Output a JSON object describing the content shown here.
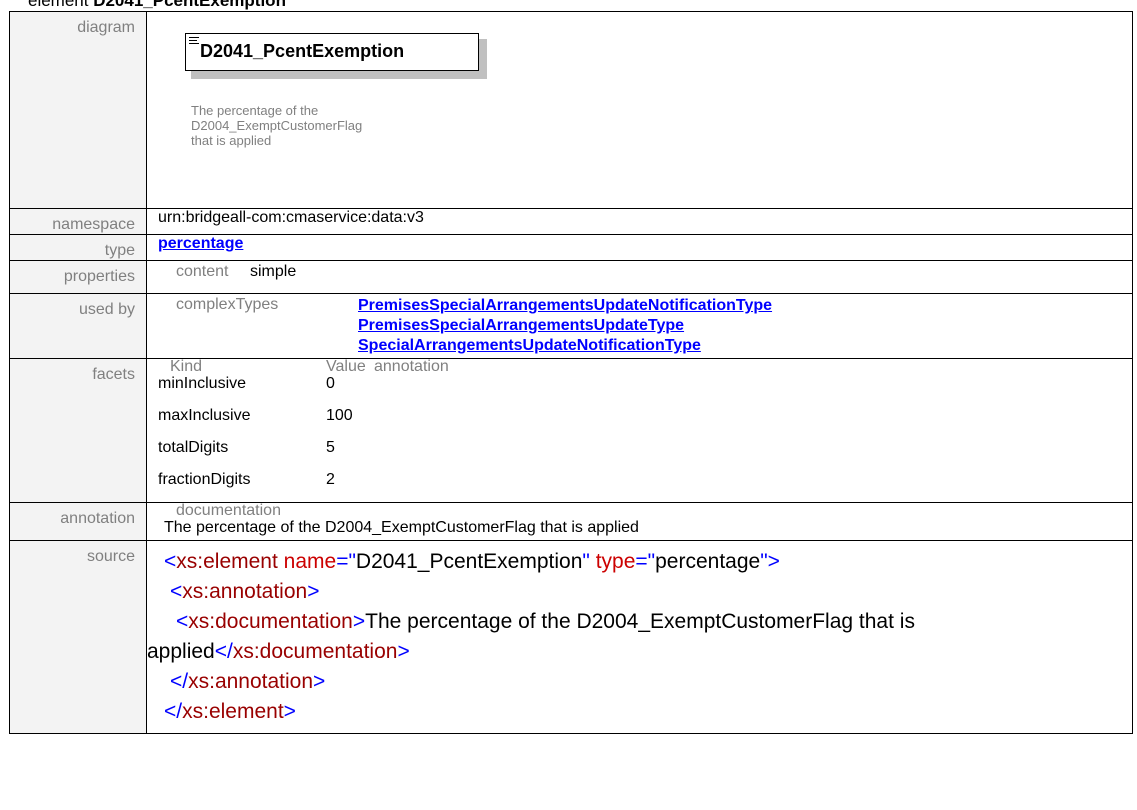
{
  "heading": {
    "prefix": "element ",
    "name": "D2041_PcentExemption"
  },
  "labels": {
    "diagram": "diagram",
    "namespace": "namespace",
    "type": "type",
    "properties": "properties",
    "used_by": "used by",
    "facets": "facets",
    "annotation": "annotation",
    "source": "source"
  },
  "diagram": {
    "element_name": "D2041_PcentExemption",
    "description_lines": [
      "The percentage of the",
      "D2004_ExemptCustomerFlag",
      "that is applied"
    ],
    "icon": "element-list-icon"
  },
  "namespace": "urn:bridgeall-com:cmaservice:data:v3",
  "type_link": "percentage",
  "properties": {
    "key": "content",
    "value": "simple"
  },
  "used_by": {
    "key": "complexTypes",
    "links": [
      "PremisesSpecialArrangementsUpdateNotificationType",
      "PremisesSpecialArrangementsUpdateType",
      "SpecialArrangementsUpdateNotificationType"
    ]
  },
  "facets": {
    "headers": [
      "Kind",
      "Value",
      "annotation"
    ],
    "rows": [
      {
        "kind": "minInclusive",
        "value": "0"
      },
      {
        "kind": "maxInclusive",
        "value": "100"
      },
      {
        "kind": "totalDigits",
        "value": "5"
      },
      {
        "kind": "fractionDigits",
        "value": "2"
      }
    ]
  },
  "annotation": {
    "header": "documentation",
    "text": "The percentage of the D2004_ExemptCustomerFlag that is applied"
  },
  "source": {
    "tag_element": "xs:element",
    "attr_name": "name",
    "attr_name_value": "D2041_PcentExemption",
    "attr_type": "type",
    "attr_type_value": "percentage",
    "tag_annotation": "xs:annotation",
    "tag_documentation": "xs:documentation",
    "doc_text_line1": "The percentage of the D2004_ExemptCustomerFlag that is",
    "doc_text_line2": "applied"
  },
  "colors": {
    "label_bg": "#f3f3f3",
    "label_text": "#808080",
    "link": "#0000ff",
    "xml_tag": "#990000",
    "xml_punct": "#0000ff",
    "xml_attr": "#cc0000"
  }
}
